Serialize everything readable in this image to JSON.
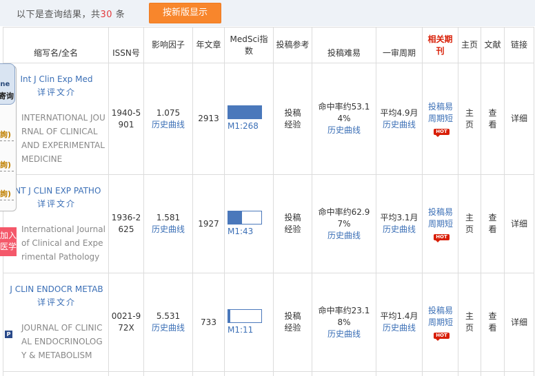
{
  "top": {
    "summary_prefix": "以下是查询结果，共",
    "count": "30",
    "summary_suffix": "条",
    "new_version_button": "按新版显示"
  },
  "headers": {
    "name": "缩写名/全名",
    "issn": "ISSN号",
    "impact": "影响因子",
    "articles": "年文章",
    "medsci": "MedSci指数",
    "submit_ref": "投稿参考",
    "difficulty": "投稿难易",
    "review": "一审周期",
    "related": "相关期刊",
    "homepage": "主页",
    "literature": "文献",
    "link": "链接"
  },
  "rows": [
    {
      "abbr": "Int J Clin Exp Med",
      "detail": "详评文介",
      "full": "INTERNATIONAL JOURNAL OF CLINICAL AND EXPERIMENTAL MEDICINE",
      "has_p_icon": false,
      "issn": "1940-5901",
      "impact": "1.075",
      "impact_link": "历史曲线",
      "articles": "2913",
      "medsci_fraction": 1.0,
      "medsci_label": "M1:268",
      "submit_ref": "投稿经验",
      "difficulty": "命中率约53.14%",
      "difficulty_link": "历史曲线",
      "review": "平均4.9月",
      "review_link": "历史曲线",
      "related": "投稿易周期短",
      "hot": "HOT",
      "homepage": "主页",
      "literature": "查看",
      "link": "详细"
    },
    {
      "abbr": "INT J CLIN EXP PATHO",
      "detail": "详评文介",
      "full": "International Journal of Clinical and Experimental Pathology",
      "has_p_icon": false,
      "issn": "1936-2625",
      "impact": "1.581",
      "impact_link": "历史曲线",
      "articles": "1927",
      "medsci_fraction": 0.42,
      "medsci_label": "M1:43",
      "submit_ref": "投稿经验",
      "difficulty": "命中率约62.97%",
      "difficulty_link": "历史曲线",
      "review": "平均3.1月",
      "review_link": "历史曲线",
      "related": "投稿易周期短",
      "hot": "HOT",
      "homepage": "主页",
      "literature": "查看",
      "link": "详细"
    },
    {
      "abbr": "J CLIN ENDOCR METAB",
      "detail": "详评文介",
      "full": "JOURNAL OF CLINICAL ENDOCRINOLOGY & METABOLISM",
      "has_p_icon": true,
      "p_icon": "P",
      "issn": "0021-972X",
      "impact": "5.531",
      "impact_link": "历史曲线",
      "articles": "733",
      "medsci_fraction": 0.06,
      "medsci_label": "M1:11",
      "submit_ref": "投稿经验",
      "difficulty": "命中率约23.18%",
      "difficulty_link": "历史曲线",
      "review": "平均1.4月",
      "review_link": "历史曲线",
      "related": "投稿易周期短",
      "hot": "HOT",
      "homepage": "主页",
      "literature": "查看",
      "link": "详细"
    }
  ],
  "sidebar": {
    "brand_line1": "ine",
    "brand_line2": "寄询",
    "items": [
      "詢)",
      "詢)",
      "詢)"
    ],
    "join_line1": "加入",
    "join_line2": "医学"
  },
  "colors": {
    "accent_orange": "#f8862c",
    "link_blue": "#3b6fb6",
    "bar_blue": "#4a78bb",
    "hot_red": "#d81e06",
    "count_red": "#e4393c"
  }
}
